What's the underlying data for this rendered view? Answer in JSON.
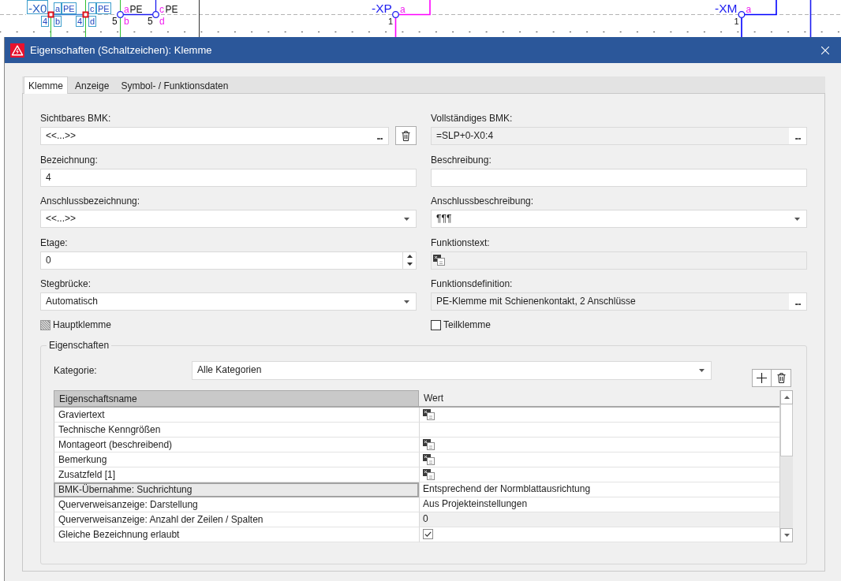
{
  "schematic": {
    "terminal_strip": {
      "tag": "-X0",
      "terminals": [
        {
          "top": "a",
          "potential": "PE",
          "number": "4",
          "bottom": "b"
        },
        {
          "top": "c",
          "potential": "PE",
          "number": "4",
          "bottom": "d"
        }
      ]
    },
    "connection_points": [
      {
        "number": "5",
        "top": "a",
        "bottom": "b",
        "potential": "PE"
      },
      {
        "number": "5",
        "top": "c",
        "bottom": "d",
        "potential": "PE"
      }
    ],
    "devices": [
      {
        "tag": "-XP",
        "connection": "a",
        "pin": "1",
        "color": "#ff00ff"
      },
      {
        "tag": "-XM",
        "connection": "a",
        "pin": "1",
        "color": "#0000ff"
      }
    ]
  },
  "dialog": {
    "title": "Eigenschaften (Schaltzeichen): Klemme",
    "tabs": [
      {
        "label": "Klemme",
        "selected": true
      },
      {
        "label": "Anzeige",
        "selected": false
      },
      {
        "label": "Symbol- / Funktionsdaten",
        "selected": false
      }
    ],
    "fields": [
      {
        "kind": "picker",
        "label": "Sichtbares BMK:",
        "value": "<<...>>",
        "button": "...",
        "readonly": false,
        "deletable": true
      },
      {
        "kind": "picker",
        "label": "Vollständiges BMK:",
        "value": "=SLP+0-X0:4",
        "button": "...",
        "readonly": true,
        "deletable": false
      },
      {
        "kind": "text",
        "label": "Bezeichnung:",
        "value": "4",
        "readonly": false
      },
      {
        "kind": "text",
        "label": "Beschreibung:",
        "readonly": false
      },
      {
        "kind": "dropdown",
        "label": "Anschlussbezeichnung:",
        "value": "<<...>>"
      },
      {
        "kind": "dropdown",
        "label": "Anschlussbeschreibung:",
        "value": "¶¶¶"
      },
      {
        "kind": "spinner",
        "label": "Etage:",
        "value": "0"
      },
      {
        "kind": "multilang",
        "label": "Funktionstext:",
        "readonly": true
      },
      {
        "kind": "dropdown",
        "label": "Stegbrücke:",
        "value": "Automatisch"
      },
      {
        "kind": "picker",
        "label": "Funktionsdefinition:",
        "value": "PE-Klemme mit Schienenkontakt, 2 Anschlüsse",
        "button": "...",
        "readonly": true,
        "deletable": false
      },
      {
        "kind": "checkbox",
        "label": "Hauptklemme",
        "checked": false,
        "indeterminate": true
      },
      {
        "kind": "checkbox",
        "label": "Teilklemme",
        "checked": false,
        "indeterminate": false
      }
    ],
    "properties": {
      "title": "Eigenschaften",
      "category_label": "Kategorie:",
      "category": "Alle Kategorien",
      "columns": [
        {
          "label": "Eigenschaftsname",
          "selected": true
        },
        {
          "label": "Wert",
          "selected": false
        }
      ],
      "rows": [
        {
          "name": "Graviertext",
          "kind": "multilang",
          "selected": false,
          "readonly": false
        },
        {
          "name": "Technische Kenngrößen",
          "kind": "text",
          "selected": false,
          "readonly": false
        },
        {
          "name": "Montageort (beschreibend)",
          "kind": "multilang",
          "selected": false,
          "readonly": false
        },
        {
          "name": "Bemerkung",
          "kind": "multilang",
          "selected": false,
          "readonly": false
        },
        {
          "name": "Zusatzfeld [1]",
          "kind": "multilang",
          "selected": false,
          "readonly": false
        },
        {
          "name": "BMK-Übernahme: Suchrichtung",
          "kind": "text",
          "value": "Entsprechend der Normblattausrichtung",
          "selected": true,
          "readonly": false
        },
        {
          "name": "Querverweisanzeige: Darstellung",
          "kind": "text",
          "value": "Aus Projekteinstellungen",
          "selected": false,
          "readonly": false
        },
        {
          "name": "Querverweisanzeige: Anzahl der Zeilen / Spalten",
          "kind": "text",
          "value": "0",
          "selected": false,
          "readonly": true
        },
        {
          "name": "Gleiche Bezeichnung erlaubt",
          "kind": "checkbox",
          "checked": true,
          "selected": false,
          "readonly": false
        }
      ]
    }
  }
}
